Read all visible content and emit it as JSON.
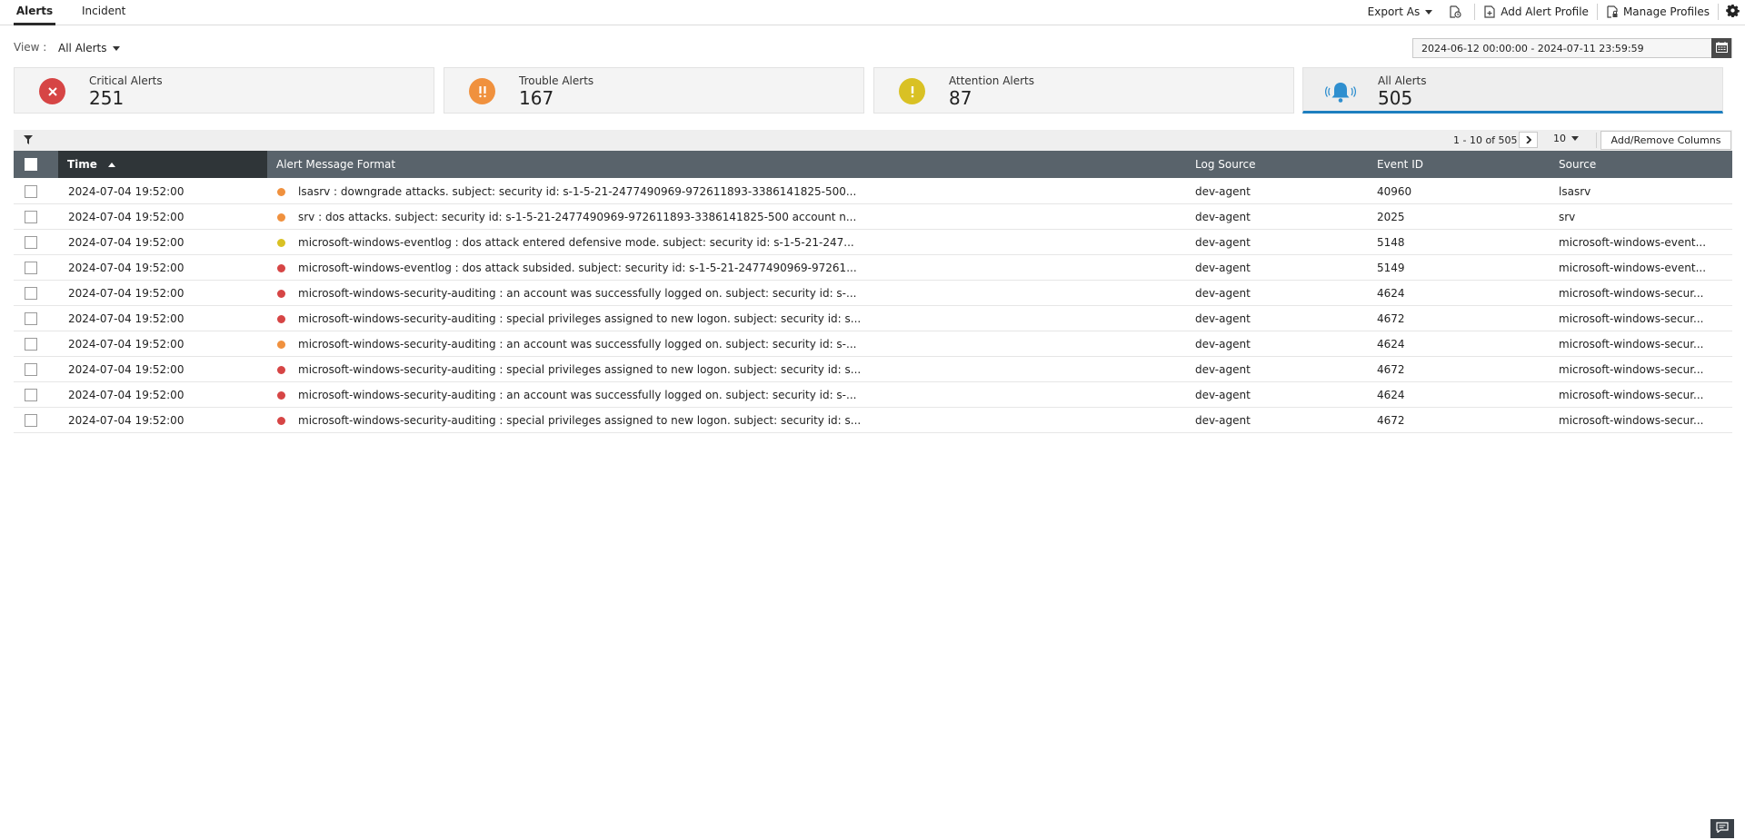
{
  "tabs": [
    {
      "label": "Alerts",
      "active": true
    },
    {
      "label": "Incident",
      "active": false
    }
  ],
  "toolbar": {
    "export_label": "Export As",
    "add_profile_label": "Add Alert Profile",
    "manage_profiles_label": "Manage Profiles"
  },
  "view": {
    "label": "View :",
    "selected": "All Alerts"
  },
  "date_range": "2024-06-12 00:00:00 - 2024-07-11 23:59:59",
  "cards": [
    {
      "title": "Critical Alerts",
      "count": "251",
      "icon": "x-circle-icon",
      "color": "#d64545"
    },
    {
      "title": "Trouble Alerts",
      "count": "167",
      "icon": "double-exclamation-icon",
      "color": "#f0913e"
    },
    {
      "title": "Attention Alerts",
      "count": "87",
      "icon": "exclamation-icon",
      "color": "#d9c124"
    },
    {
      "title": "All Alerts",
      "count": "505",
      "icon": "bell-icon",
      "color": "#2f8fcf",
      "active": true
    }
  ],
  "pager": {
    "range": "1 - 10 of 505",
    "page_size": "10",
    "add_columns": "Add/Remove Columns"
  },
  "columns": [
    "Time",
    "Alert Message Format",
    "Log Source",
    "Event ID",
    "Source"
  ],
  "severity_colors": {
    "critical": "#d64545",
    "trouble": "#f0913e",
    "attention": "#d9c124"
  },
  "rows": [
    {
      "time": "2024-07-04 19:52:00",
      "severity": "trouble",
      "message": "lsasrv : downgrade attacks. subject: security id: s-1-5-21-2477490969-972611893-3386141825-500...",
      "log_source": "dev-agent",
      "event_id": "40960",
      "source": "lsasrv"
    },
    {
      "time": "2024-07-04 19:52:00",
      "severity": "trouble",
      "message": "srv : dos attacks. subject: security id: s-1-5-21-2477490969-972611893-3386141825-500 account n...",
      "log_source": "dev-agent",
      "event_id": "2025",
      "source": "srv"
    },
    {
      "time": "2024-07-04 19:52:00",
      "severity": "attention",
      "message": "microsoft-windows-eventlog : dos attack entered defensive mode. subject: security id: s-1-5-21-247...",
      "log_source": "dev-agent",
      "event_id": "5148",
      "source": "microsoft-windows-event..."
    },
    {
      "time": "2024-07-04 19:52:00",
      "severity": "critical",
      "message": "microsoft-windows-eventlog : dos attack subsided. subject: security id: s-1-5-21-2477490969-97261...",
      "log_source": "dev-agent",
      "event_id": "5149",
      "source": "microsoft-windows-event..."
    },
    {
      "time": "2024-07-04 19:52:00",
      "severity": "critical",
      "message": "microsoft-windows-security-auditing : an account was successfully logged on. subject: security id: s-...",
      "log_source": "dev-agent",
      "event_id": "4624",
      "source": "microsoft-windows-secur..."
    },
    {
      "time": "2024-07-04 19:52:00",
      "severity": "critical",
      "message": "microsoft-windows-security-auditing : special privileges assigned to new logon. subject: security id: s...",
      "log_source": "dev-agent",
      "event_id": "4672",
      "source": "microsoft-windows-secur..."
    },
    {
      "time": "2024-07-04 19:52:00",
      "severity": "trouble",
      "message": "microsoft-windows-security-auditing : an account was successfully logged on. subject: security id: s-...",
      "log_source": "dev-agent",
      "event_id": "4624",
      "source": "microsoft-windows-secur..."
    },
    {
      "time": "2024-07-04 19:52:00",
      "severity": "critical",
      "message": "microsoft-windows-security-auditing : special privileges assigned to new logon. subject: security id: s...",
      "log_source": "dev-agent",
      "event_id": "4672",
      "source": "microsoft-windows-secur..."
    },
    {
      "time": "2024-07-04 19:52:00",
      "severity": "critical",
      "message": "microsoft-windows-security-auditing : an account was successfully logged on. subject: security id: s-...",
      "log_source": "dev-agent",
      "event_id": "4624",
      "source": "microsoft-windows-secur..."
    },
    {
      "time": "2024-07-04 19:52:00",
      "severity": "critical",
      "message": "microsoft-windows-security-auditing : special privileges assigned to new logon. subject: security id: s...",
      "log_source": "dev-agent",
      "event_id": "4672",
      "source": "microsoft-windows-secur..."
    }
  ]
}
